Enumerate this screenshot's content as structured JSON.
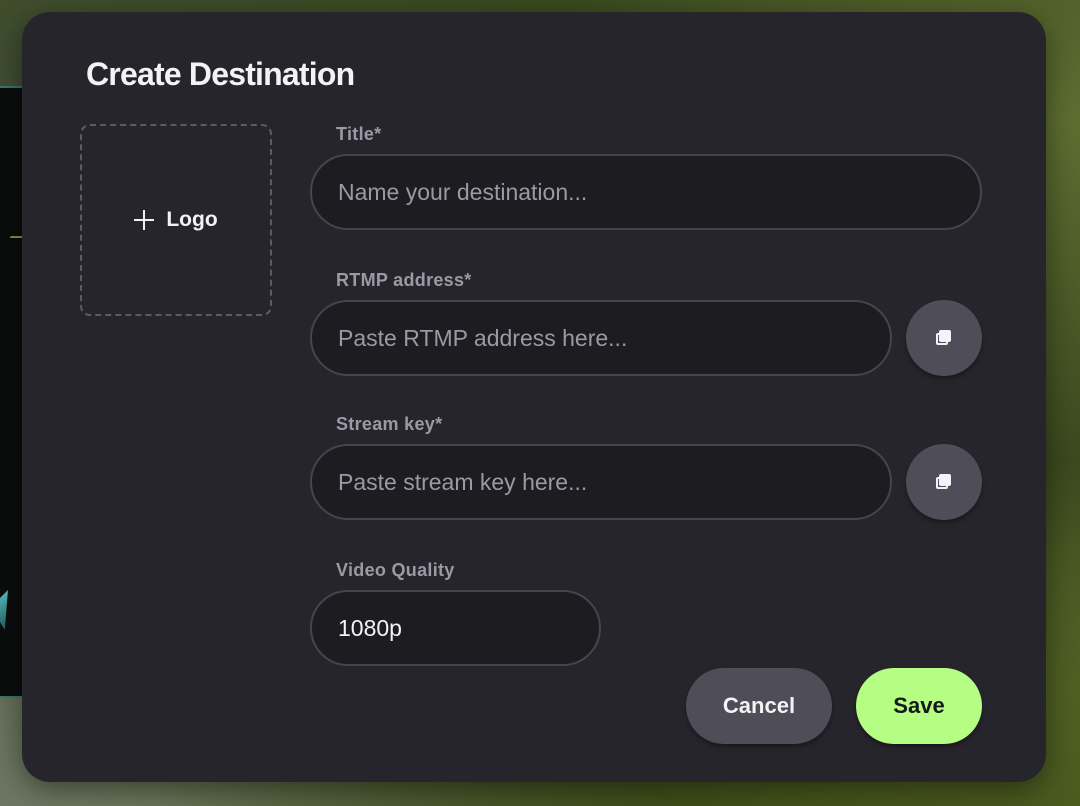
{
  "dialog": {
    "title": "Create Destination",
    "logo_label": "Logo",
    "fields": {
      "title": {
        "label": "Title*",
        "value": "",
        "placeholder": "Name your destination..."
      },
      "rtmp": {
        "label": "RTMP address*",
        "value": "",
        "placeholder": "Paste RTMP address here..."
      },
      "stream_key": {
        "label": "Stream key*",
        "value": "",
        "placeholder": "Paste stream key here..."
      },
      "video_quality": {
        "label": "Video Quality",
        "value": "1080p"
      }
    },
    "actions": {
      "cancel": "Cancel",
      "save": "Save"
    }
  },
  "icons": {
    "logo_add": "plus-icon",
    "rtmp_paste": "copy-icon",
    "stream_key_paste": "copy-icon"
  },
  "colors": {
    "dialog_bg": "#27252c",
    "input_bg": "#1d1c21",
    "secondary_button": "#4f4d58",
    "primary_button": "#b6fd84",
    "label_text": "#9c99a6"
  }
}
